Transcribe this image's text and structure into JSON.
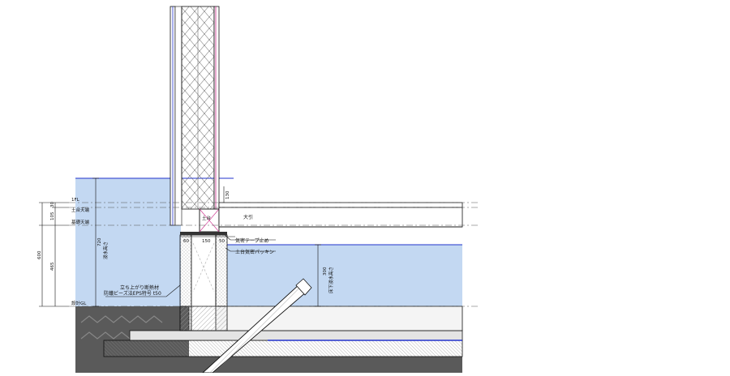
{
  "levels": {
    "fl": "1FL",
    "dodai_top": "土台天端",
    "kiso_top": "基礎天端",
    "gl": "設計GL"
  },
  "dims": {
    "d30": "30",
    "d105": "105",
    "d600": "600",
    "d465": "465",
    "d720": "720",
    "d130": "130",
    "d60": "60",
    "d150": "150",
    "d50": "50",
    "d300": "300"
  },
  "labels": {
    "flood_height": "浸水高さ",
    "underfloor_flood": "床下浸水高さ",
    "dodai": "土台",
    "obiki": "大引",
    "airtight_tape": "気密テープ止め",
    "dodai_packing": "土台気密パッキン",
    "insulation_line1": "立ち上がり断熱材",
    "insulation_line2": "防蟻ビーズ法EPS特号 t50"
  },
  "colors": {
    "water": "#c3d8f2",
    "water_line": "#2233cc",
    "ground": "#5a5a5a",
    "concrete": "#e4e4e4",
    "hatch": "#888888",
    "line": "#111111",
    "magenta": "#cc2a8a"
  }
}
